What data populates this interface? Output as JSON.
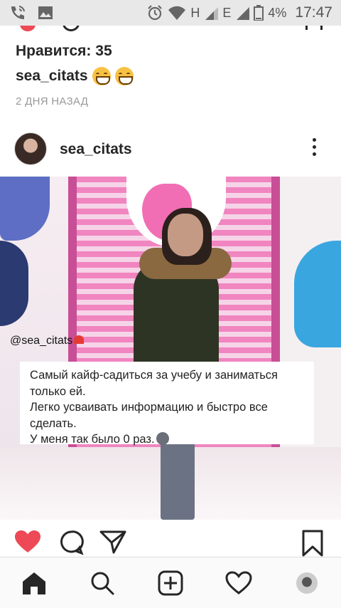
{
  "status_bar": {
    "network_1": "H",
    "network_2": "E",
    "battery": "4%",
    "time": "17:47",
    "icons": [
      "phone-wifi-icon",
      "image-icon",
      "alarm-icon",
      "wifi-icon",
      "signal-icon",
      "battery-icon"
    ]
  },
  "previous_post": {
    "likes_label": "Нравится: 35",
    "caption_user": "sea_citats",
    "caption_emojis": [
      "grinning-face-emoji",
      "grinning-face-emoji"
    ],
    "time_ago": "2 ДНЯ НАЗАД"
  },
  "post": {
    "username": "sea_citats",
    "image": {
      "watermark": "@sea_citats",
      "overlay_lines": [
        "Самый кайф-садиться за учебу и заниматься",
        "только ей.",
        "Легко усваивать информацию и быстро все",
        "сделать.",
        "У меня так было 0 раз."
      ]
    },
    "actions": [
      "heart-icon",
      "comment-icon",
      "share-icon",
      "bookmark-icon"
    ]
  },
  "bottom_nav": [
    "home-icon",
    "search-icon",
    "add-post-icon",
    "activity-heart-icon",
    "profile-avatar"
  ],
  "colors": {
    "like_red": "#ed4956",
    "text": "#262626",
    "muted": "#999999",
    "status_bar_bg": "#e8e8e8"
  }
}
